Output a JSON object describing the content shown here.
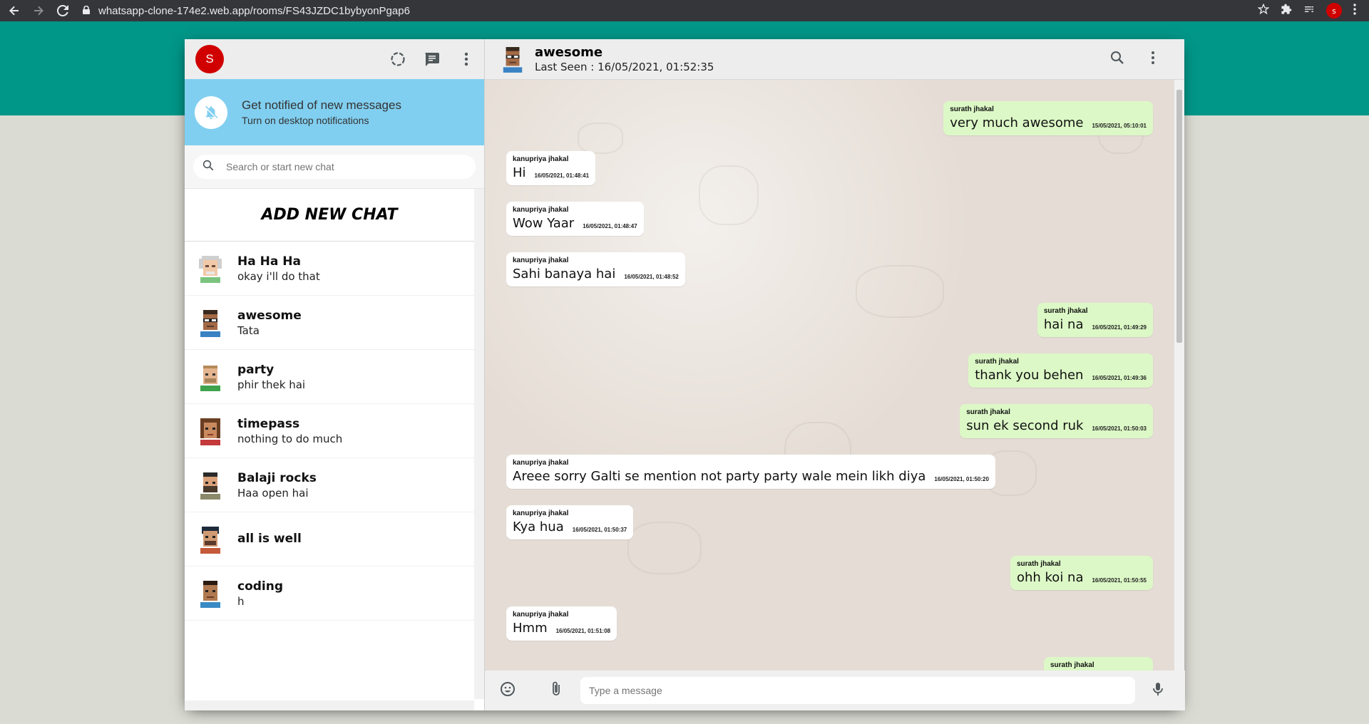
{
  "browser": {
    "url": "whatsapp-clone-174e2.web.app/rooms/FS43JZDC1bybyonPgap6",
    "profile_initial": "s"
  },
  "user": {
    "initial": "S",
    "avatar_color": "#d10000"
  },
  "notification": {
    "title": "Get notified of new messages",
    "subtitle": "Turn on desktop notifications"
  },
  "search": {
    "placeholder": "Search or start new chat"
  },
  "add_new_chat_label": "ADD NEW CHAT",
  "rooms": [
    {
      "name": "Ha Ha Ha",
      "last": "okay i'll do that"
    },
    {
      "name": "awesome",
      "last": "Tata"
    },
    {
      "name": "party",
      "last": "phir thek hai"
    },
    {
      "name": "timepass",
      "last": "nothing to do much"
    },
    {
      "name": "Balaji rocks",
      "last": "Haa open hai"
    },
    {
      "name": "all is well",
      "last": ""
    },
    {
      "name": "coding",
      "last": "h"
    }
  ],
  "chat": {
    "room_name": "awesome",
    "last_seen": "Last Seen : 16/05/2021, 01:52:35",
    "messages": [
      {
        "sender": "surath jhakal",
        "text": "very much awesome",
        "time": "15/05/2021, 05:10:01",
        "sent": true
      },
      {
        "sender": "kanupriya jhakal",
        "text": "Hi",
        "time": "16/05/2021, 01:48:41",
        "sent": false
      },
      {
        "sender": "kanupriya jhakal",
        "text": "Wow Yaar",
        "time": "16/05/2021, 01:48:47",
        "sent": false
      },
      {
        "sender": "kanupriya jhakal",
        "text": "Sahi banaya hai",
        "time": "16/05/2021, 01:48:52",
        "sent": false
      },
      {
        "sender": "surath jhakal",
        "text": "hai na",
        "time": "16/05/2021, 01:49:29",
        "sent": true
      },
      {
        "sender": "surath jhakal",
        "text": "thank you behen",
        "time": "16/05/2021, 01:49:36",
        "sent": true
      },
      {
        "sender": "surath jhakal",
        "text": "sun ek second ruk",
        "time": "16/05/2021, 01:50:03",
        "sent": true
      },
      {
        "sender": "kanupriya jhakal",
        "text": "Areee sorry Galti se mention not party party wale mein likh diya",
        "time": "16/05/2021, 01:50:20",
        "sent": false
      },
      {
        "sender": "kanupriya jhakal",
        "text": "Kya hua",
        "time": "16/05/2021, 01:50:37",
        "sent": false
      },
      {
        "sender": "surath jhakal",
        "text": "ohh koi na",
        "time": "16/05/2021, 01:50:55",
        "sent": true
      },
      {
        "sender": "kanupriya jhakal",
        "text": "Hmm",
        "time": "16/05/2021, 01:51:08",
        "sent": false
      },
      {
        "sender": "surath jhakal",
        "text": "",
        "time": "",
        "sent": true
      }
    ]
  },
  "composer": {
    "placeholder": "Type a message"
  },
  "colors": {
    "teal": "#009688",
    "sent_bubble": "#dcf8c6",
    "notification_bg": "#81cff0",
    "chat_bg": "#e5ddd5"
  }
}
